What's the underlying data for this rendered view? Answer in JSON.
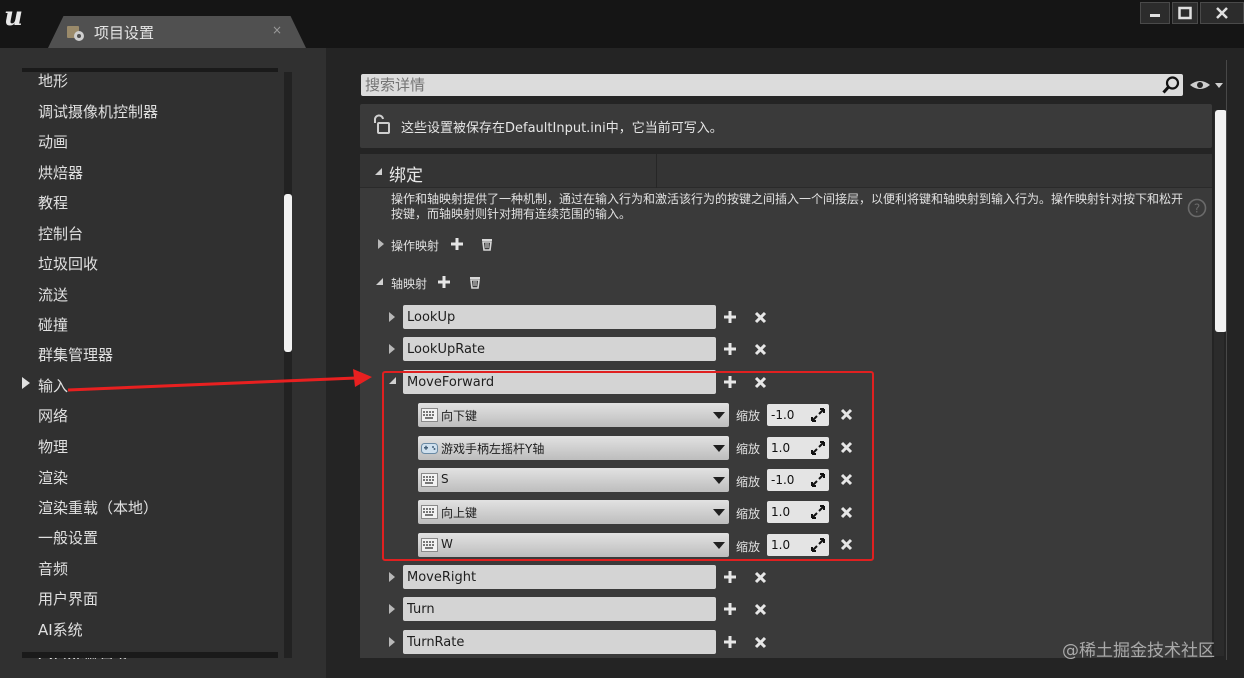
{
  "window": {
    "tab_title": "项目设置",
    "tab_close": "×"
  },
  "sidebar": {
    "items": [
      {
        "label": "地形"
      },
      {
        "label": "调试摄像机控制器"
      },
      {
        "label": "动画"
      },
      {
        "label": "烘焙器"
      },
      {
        "label": "教程"
      },
      {
        "label": "控制台"
      },
      {
        "label": "垃圾回收"
      },
      {
        "label": "流送"
      },
      {
        "label": "碰撞"
      },
      {
        "label": "群集管理器"
      },
      {
        "label": "输入"
      },
      {
        "label": "网络"
      },
      {
        "label": "物理"
      },
      {
        "label": "渲染"
      },
      {
        "label": "渲染重载（本地）"
      },
      {
        "label": "一般设置"
      },
      {
        "label": "音频"
      },
      {
        "label": "用户界面"
      },
      {
        "label": "AI系统"
      },
      {
        "label": "Chaos解算器"
      }
    ],
    "selected": "输入"
  },
  "details": {
    "search_placeholder": "搜索详情",
    "info_text": "这些设置被保存在DefaultInput.ini中，它当前可写入。",
    "section_title": "绑定",
    "description": "操作和轴映射提供了一种机制，通过在输入行为和激活该行为的按键之间插入一个间接层，以便利将键和轴映射到输入行为。操作映射针对按下和松开按键，而轴映射则针对拥有连续范围的输入。",
    "action_mappings_label": "操作映射",
    "axis_mappings_label": "轴映射",
    "scale_label": "缩放",
    "axis_mappings": [
      {
        "name": "LookUp",
        "expanded": false
      },
      {
        "name": "LookUpRate",
        "expanded": false
      },
      {
        "name": "MoveForward",
        "expanded": true,
        "keys": [
          {
            "key": "向下键",
            "icon": "keyboard-icon",
            "scale": "-1.0"
          },
          {
            "key": "游戏手柄左摇杆Y轴",
            "icon": "gamepad-icon",
            "scale": "1.0"
          },
          {
            "key": "S",
            "icon": "keyboard-icon",
            "scale": "-1.0"
          },
          {
            "key": "向上键",
            "icon": "keyboard-icon",
            "scale": "1.0"
          },
          {
            "key": "W",
            "icon": "keyboard-icon",
            "scale": "1.0"
          }
        ]
      },
      {
        "name": "MoveRight",
        "expanded": false
      },
      {
        "name": "Turn",
        "expanded": false
      },
      {
        "name": "TurnRate",
        "expanded": false
      }
    ]
  },
  "watermark": "@稀土掘金技术社区",
  "colors": {
    "highlight_box": "#e02020",
    "arrow": "#e82020",
    "panel_bg": "#3a3a3a"
  }
}
